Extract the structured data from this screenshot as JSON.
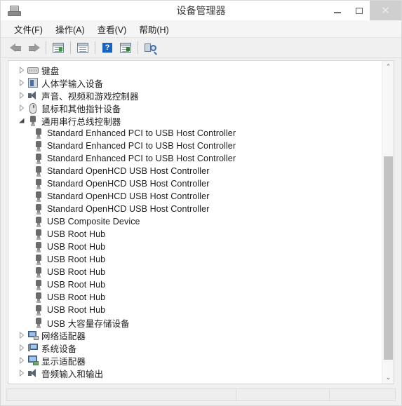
{
  "window": {
    "title": "设备管理器",
    "icon": "device-manager-icon",
    "caption": {
      "minimize": "minimize-icon",
      "maximize": "maximize-icon",
      "close": "✕"
    }
  },
  "menubar": {
    "items": [
      {
        "label": "文件(F)",
        "name": "menu-file"
      },
      {
        "label": "操作(A)",
        "name": "menu-action"
      },
      {
        "label": "查看(V)",
        "name": "menu-view"
      },
      {
        "label": "帮助(H)",
        "name": "menu-help"
      }
    ]
  },
  "toolbar": {
    "buttons": [
      {
        "name": "back-button",
        "icon": "arrow-left-icon"
      },
      {
        "name": "forward-button",
        "icon": "arrow-right-icon"
      },
      {
        "name": "separator-1",
        "icon": "separator"
      },
      {
        "name": "show-hide-console-tree-button",
        "icon": "console-tree-icon"
      },
      {
        "name": "separator-2",
        "icon": "separator"
      },
      {
        "name": "properties-button",
        "icon": "properties-icon"
      },
      {
        "name": "separator-3",
        "icon": "separator"
      },
      {
        "name": "help-button",
        "icon": "help-icon"
      },
      {
        "name": "update-driver-button",
        "icon": "update-driver-icon"
      },
      {
        "name": "separator-4",
        "icon": "separator"
      },
      {
        "name": "scan-hardware-changes-button",
        "icon": "scan-hardware-icon"
      }
    ],
    "help_glyph": "?"
  },
  "tree": {
    "rows": [
      {
        "label": "键盘",
        "icon": "keyboard-icon",
        "state": "collapsed",
        "level": 1,
        "lang": "cn"
      },
      {
        "label": "人体学输入设备",
        "icon": "hid-icon",
        "state": "collapsed",
        "level": 1,
        "lang": "cn"
      },
      {
        "label": "声音、视频和游戏控制器",
        "icon": "sound-icon",
        "state": "collapsed",
        "level": 1,
        "lang": "cn"
      },
      {
        "label": "鼠标和其他指针设备",
        "icon": "mouse-icon",
        "state": "collapsed",
        "level": 1,
        "lang": "cn"
      },
      {
        "label": "通用串行总线控制器",
        "icon": "usb-icon",
        "state": "expanded",
        "level": 1,
        "lang": "cn"
      },
      {
        "label": "Standard Enhanced PCI to USB Host Controller",
        "icon": "usb-icon",
        "state": "leaf",
        "level": 2,
        "lang": "en"
      },
      {
        "label": "Standard Enhanced PCI to USB Host Controller",
        "icon": "usb-icon",
        "state": "leaf",
        "level": 2,
        "lang": "en"
      },
      {
        "label": "Standard Enhanced PCI to USB Host Controller",
        "icon": "usb-icon",
        "state": "leaf",
        "level": 2,
        "lang": "en"
      },
      {
        "label": "Standard OpenHCD USB Host Controller",
        "icon": "usb-icon",
        "state": "leaf",
        "level": 2,
        "lang": "en"
      },
      {
        "label": "Standard OpenHCD USB Host Controller",
        "icon": "usb-icon",
        "state": "leaf",
        "level": 2,
        "lang": "en"
      },
      {
        "label": "Standard OpenHCD USB Host Controller",
        "icon": "usb-icon",
        "state": "leaf",
        "level": 2,
        "lang": "en"
      },
      {
        "label": "Standard OpenHCD USB Host Controller",
        "icon": "usb-icon",
        "state": "leaf",
        "level": 2,
        "lang": "en"
      },
      {
        "label": "USB Composite Device",
        "icon": "usb-icon",
        "state": "leaf",
        "level": 2,
        "lang": "en"
      },
      {
        "label": "USB Root Hub",
        "icon": "usb-icon",
        "state": "leaf",
        "level": 2,
        "lang": "en"
      },
      {
        "label": "USB Root Hub",
        "icon": "usb-icon",
        "state": "leaf",
        "level": 2,
        "lang": "en"
      },
      {
        "label": "USB Root Hub",
        "icon": "usb-icon",
        "state": "leaf",
        "level": 2,
        "lang": "en"
      },
      {
        "label": "USB Root Hub",
        "icon": "usb-icon",
        "state": "leaf",
        "level": 2,
        "lang": "en"
      },
      {
        "label": "USB Root Hub",
        "icon": "usb-icon",
        "state": "leaf",
        "level": 2,
        "lang": "en"
      },
      {
        "label": "USB Root Hub",
        "icon": "usb-icon",
        "state": "leaf",
        "level": 2,
        "lang": "en"
      },
      {
        "label": "USB Root Hub",
        "icon": "usb-icon",
        "state": "leaf",
        "level": 2,
        "lang": "en"
      },
      {
        "label": "USB 大容量存储设备",
        "icon": "usb-icon",
        "state": "leaf",
        "level": 2,
        "lang": "cn"
      },
      {
        "label": "网络适配器",
        "icon": "network-icon",
        "state": "collapsed",
        "level": 1,
        "lang": "cn"
      },
      {
        "label": "系统设备",
        "icon": "system-icon",
        "state": "collapsed",
        "level": 1,
        "lang": "cn"
      },
      {
        "label": "显示适配器",
        "icon": "display-icon",
        "state": "collapsed",
        "level": 1,
        "lang": "cn"
      },
      {
        "label": "音频输入和输出",
        "icon": "audio-icon",
        "state": "collapsed",
        "level": 1,
        "lang": "cn"
      }
    ]
  },
  "scrollbar": {
    "up_glyph": "⌃",
    "down_glyph": "⌄",
    "thumb_top_pct": 28,
    "thumb_height_pct": 68
  },
  "statusbar": {
    "pane1": "",
    "pane2": "",
    "pane3": ""
  }
}
